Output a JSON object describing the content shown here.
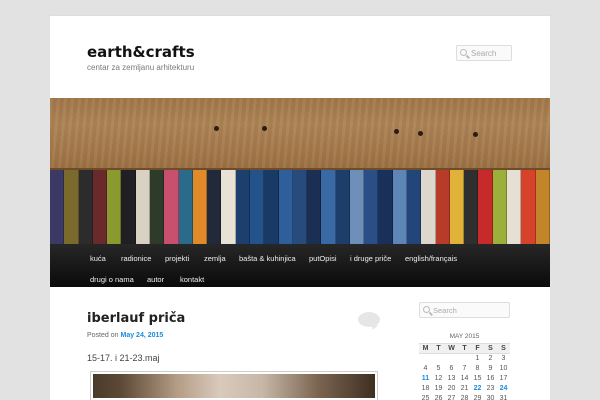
{
  "site": {
    "title": "earth&crafts",
    "description": "centar za zemljanu arhitekturu",
    "search_placeholder": "Search"
  },
  "nav": {
    "items": [
      "kuća",
      "radionice",
      "projekti",
      "zemlja",
      "bašta & kuhinjica",
      "putOpisi",
      "i druge priče",
      "english/français",
      "drugi o nama",
      "autor",
      "kontakt"
    ]
  },
  "post": {
    "title": "iberlauf priča",
    "posted_on": "Posted on",
    "date": "May 24, 2015",
    "text": "15-17. i 21-23.maj"
  },
  "sidebar": {
    "search_placeholder": "Search",
    "calendar": {
      "caption": "MAY 2015",
      "weekdays": [
        "M",
        "T",
        "W",
        "T",
        "F",
        "S",
        "S"
      ],
      "rows": [
        [
          "",
          "",
          "",
          "",
          "1",
          "2",
          "3"
        ],
        [
          "4",
          "5",
          "6",
          "7",
          "8",
          "9",
          "10"
        ],
        [
          "11",
          "12",
          "13",
          "14",
          "15",
          "16",
          "17"
        ],
        [
          "18",
          "19",
          "20",
          "21",
          "22",
          "23",
          "24"
        ],
        [
          "25",
          "26",
          "27",
          "28",
          "29",
          "30",
          "31"
        ]
      ],
      "linked_days": [
        "11",
        "22",
        "24"
      ]
    }
  },
  "colors": {
    "link": "#1b8be0",
    "nav_background": "#1a1a1a",
    "page_background": "#e2e2e2"
  }
}
